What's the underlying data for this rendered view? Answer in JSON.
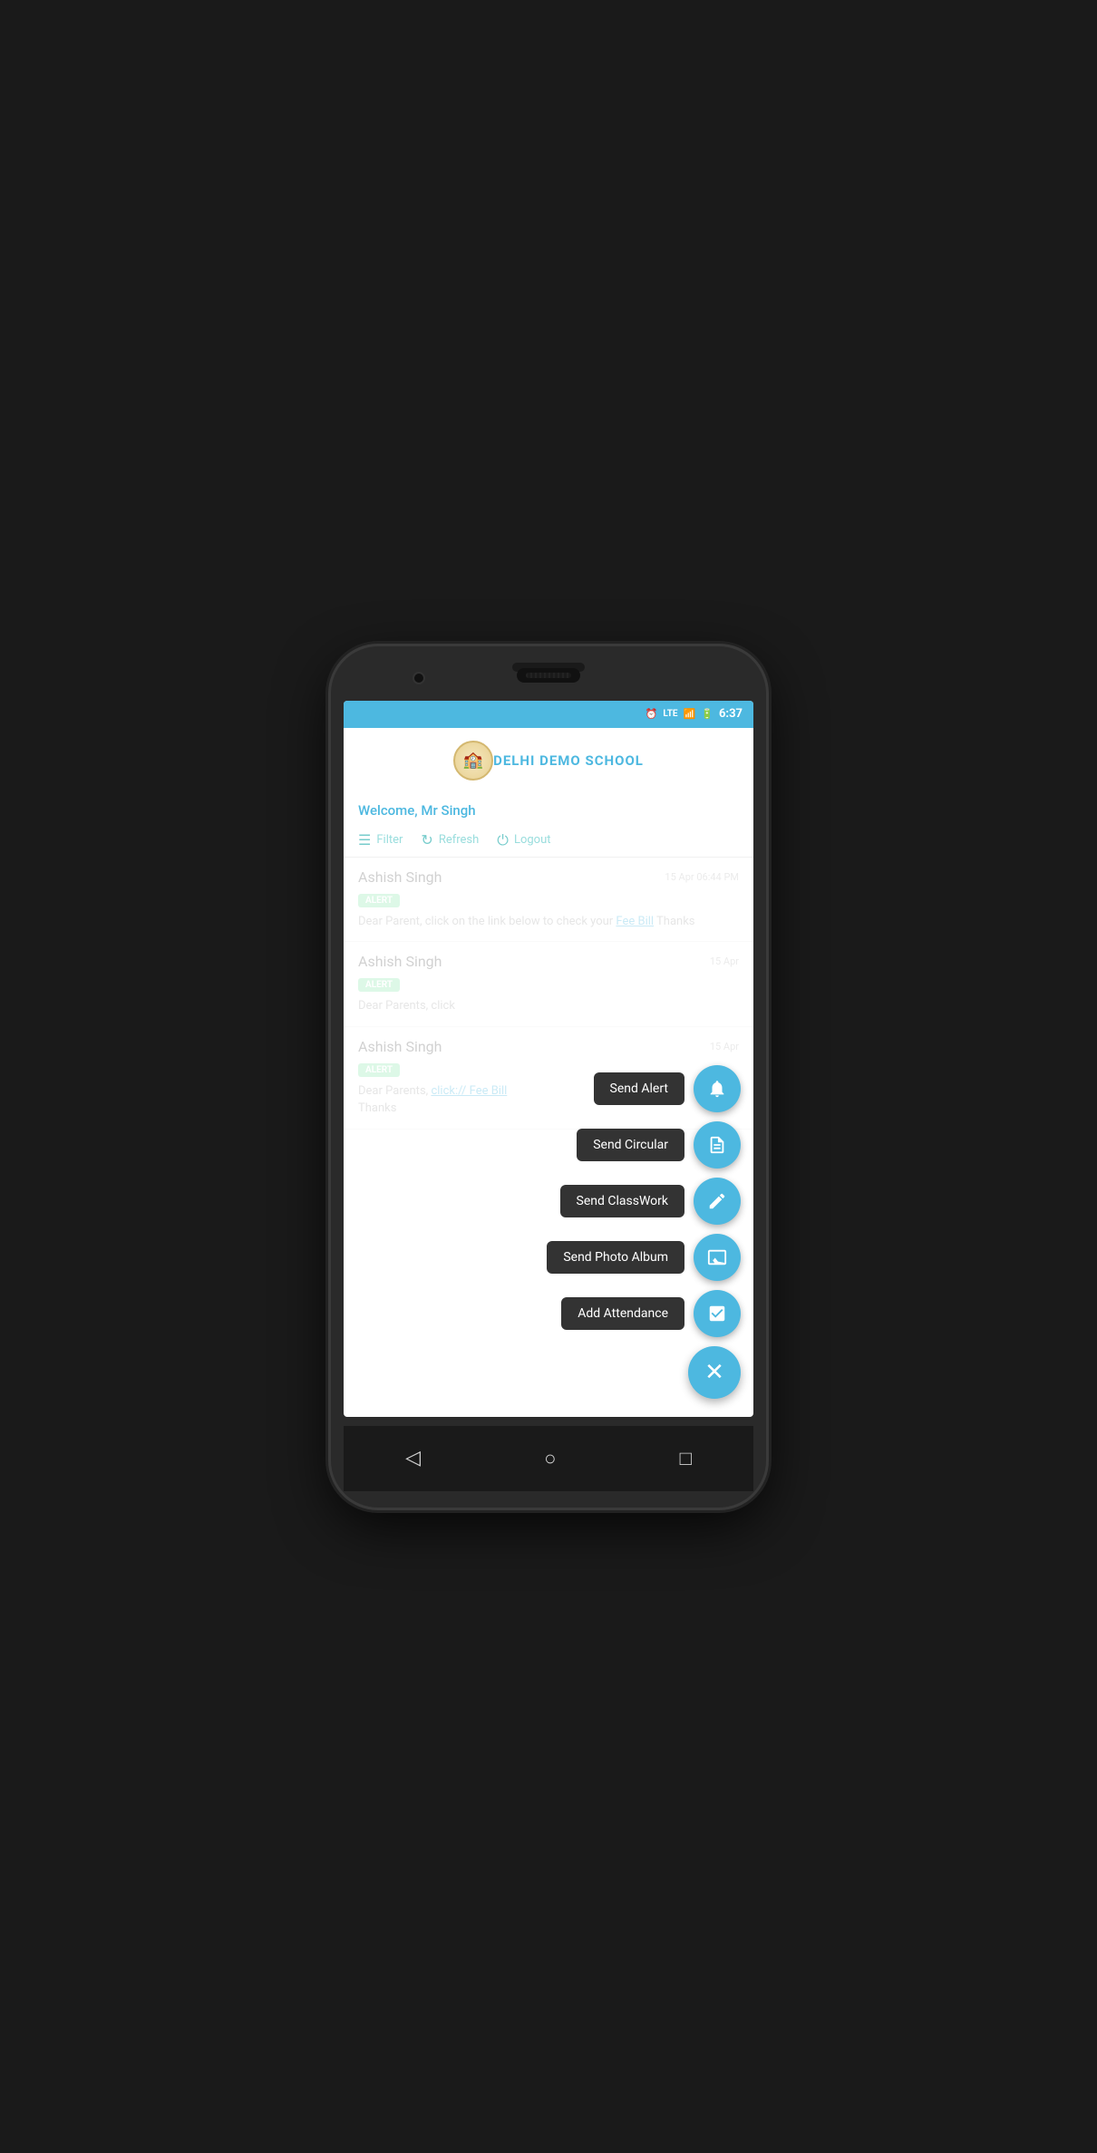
{
  "phone": {
    "time": "6:37",
    "status_icons": [
      "⏰",
      "LTE",
      "📶",
      "🔋"
    ]
  },
  "header": {
    "school_name": "DELHI DEMO SCHOOL",
    "logo_emoji": "🏫"
  },
  "welcome": {
    "text": "Welcome, Mr Singh"
  },
  "toolbar": {
    "filter_label": "Filter",
    "refresh_label": "Refresh",
    "logout_label": "Logout"
  },
  "cards": [
    {
      "name": "Ashish Singh",
      "badge": "ALERT",
      "time": "15 Apr 06:44 PM",
      "message": "Dear Parent, click on the link below to check your ",
      "link_text": "Fee Bill",
      "message_after": " Thanks"
    },
    {
      "name": "Ashish Singh",
      "badge": "ALERT",
      "time": "15 Apr",
      "message": "Dear Parents, click ",
      "link_text": "",
      "message_after": ""
    },
    {
      "name": "Ashish Singh",
      "badge": "ALERT",
      "time": "15 Apr",
      "message": "Dear Parents, ",
      "link_text": "click:// Fee Bill",
      "message_after": "\nThanks"
    }
  ],
  "fab_menu": {
    "items": [
      {
        "label": "Send Alert",
        "icon_type": "bell"
      },
      {
        "label": "Send Circular",
        "icon_type": "document"
      },
      {
        "label": "Send ClassWork",
        "icon_type": "edit-doc"
      },
      {
        "label": "Send Photo Album",
        "icon_type": "photo"
      },
      {
        "label": "Add Attendance",
        "icon_type": "check"
      }
    ],
    "close_icon": "✕"
  },
  "nav": {
    "back_icon": "◁",
    "home_icon": "○",
    "recent_icon": "□"
  }
}
